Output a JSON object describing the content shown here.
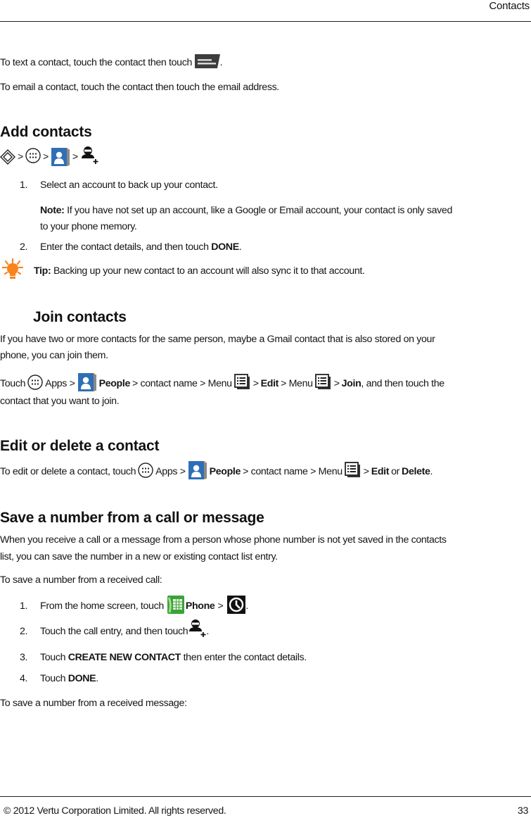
{
  "header": {
    "section_title": "Contacts"
  },
  "intro": {
    "text_contact_prefix": "To text a contact, touch the contact then touch",
    "text_contact_suffix": ".",
    "email_contact": "To email a contact, touch the contact then touch the email address."
  },
  "add_contacts": {
    "heading": "Add contacts",
    "path_separator": ">",
    "steps": [
      {
        "num": "1.",
        "text": "Select an account to back up your contact."
      },
      {
        "num": "2.",
        "text_prefix": "Enter the contact details, and then touch",
        "bold": "DONE",
        "text_suffix": "."
      }
    ],
    "note_label": "Note:",
    "note_line1": "If you have not set up an account, like a Google or Email account, your contact is only saved",
    "note_line2": "to your phone memory.",
    "tip_label": "Tip:",
    "tip_text": "Backing up your new contact to an account will also sync it to that account."
  },
  "join_contacts": {
    "heading": "Join contacts",
    "para_line1": "If you have two or more contacts for the same person, maybe a Gmail contact that is also stored on your",
    "para_line2": "phone, you can join them.",
    "touch": "Touch",
    "apps": "Apps >",
    "people": "People",
    "contact_name_menu": "> contact name > Menu",
    "gt": ">",
    "edit": "Edit",
    "menu": "> Menu",
    "join": "Join",
    "tail": ", and then touch the",
    "line2": "contact that you want to join."
  },
  "edit_delete": {
    "heading": "Edit or delete a contact",
    "prefix": "To edit or delete a contact, touch",
    "apps": "Apps >",
    "people": "People",
    "contact_name_menu": "> contact name > Menu",
    "gt": ">",
    "edit": "Edit",
    "or": "or",
    "delete": "Delete",
    "period": "."
  },
  "save_number": {
    "heading": "Save a number from a call or message",
    "para_line1": "When you receive a call or a message from a person whose phone number is not yet saved in the contacts",
    "para_line2": "list, you can save the number in a new or existing contact list entry.",
    "call_intro": "To save a number from a received call:",
    "steps": [
      {
        "num": "1.",
        "text_prefix": "From the home screen, touch",
        "bold": "Phone",
        "text_suffix": ">"
      },
      {
        "num": "2.",
        "text_prefix": "Touch the call entry, and then touch"
      },
      {
        "num": "3.",
        "text_prefix": "Touch",
        "bold": "CREATE NEW CONTACT",
        "text_suffix": "then enter the contact details."
      },
      {
        "num": "4.",
        "text_prefix": "Touch",
        "bold": "DONE",
        "text_suffix": "."
      }
    ],
    "message_intro": "To save a number from a received message:"
  },
  "footer": {
    "copyright": "© 2012 Vertu Corporation Limited. All rights reserved.",
    "page_number": "33"
  },
  "icons": {
    "message": "message-icon",
    "home": "home-diamond-icon",
    "apps": "apps-grid-icon",
    "people": "people-app-icon",
    "add_contact": "add-contact-icon",
    "menu": "menu-list-icon",
    "tip": "lightbulb-icon",
    "phone": "phone-app-icon",
    "call_log": "call-log-clock-icon"
  },
  "colors": {
    "tip_orange": "#f7841e",
    "people_blue": "#2f6fb6",
    "phone_green": "#3aa23a"
  }
}
